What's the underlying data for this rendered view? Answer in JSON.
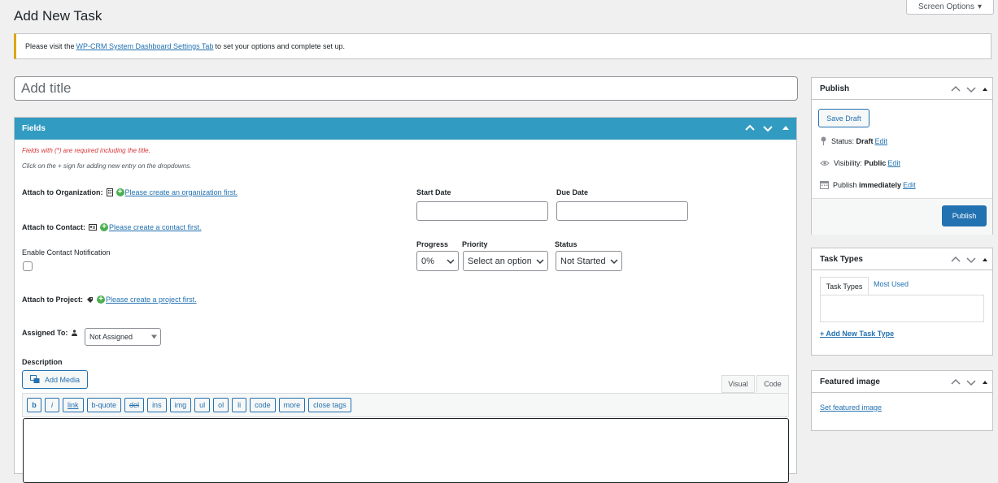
{
  "page": {
    "title": "Add New Task"
  },
  "screen_options": {
    "label": "Screen Options"
  },
  "notice": {
    "prefix": "Please visit the ",
    "link": "WP-CRM System Dashboard Settings Tab",
    "suffix": " to set your options and complete set up."
  },
  "title_field": {
    "placeholder": "Add title"
  },
  "fields": {
    "header": "Fields",
    "required_note": "Fields with (*) are required including the title.",
    "help_note": "Click on the + sign for adding new entry on the dropdowns.",
    "organization": {
      "label": "Attach to Organization:",
      "link": "Please create an organization first."
    },
    "contact": {
      "label": "Attach to Contact:",
      "link": "Please create a contact first."
    },
    "notification": {
      "label": "Enable Contact Notification"
    },
    "project": {
      "label": "Attach to Project:",
      "link": "Please create a project first."
    },
    "assigned": {
      "label": "Assigned To:",
      "value": "Not Assigned"
    },
    "start_date": {
      "label": "Start Date"
    },
    "due_date": {
      "label": "Due Date"
    },
    "progress": {
      "label": "Progress",
      "value": "0%"
    },
    "priority": {
      "label": "Priority",
      "value": "Select an option"
    },
    "status": {
      "label": "Status",
      "value": "Not Started"
    },
    "description": {
      "label": "Description",
      "add_media": "Add Media",
      "tab_visual": "Visual",
      "tab_code": "Code",
      "quicktags": [
        "b",
        "i",
        "link",
        "b-quote",
        "del",
        "ins",
        "img",
        "ul",
        "ol",
        "li",
        "code",
        "more",
        "close tags"
      ]
    }
  },
  "publish": {
    "header": "Publish",
    "save_draft": "Save Draft",
    "status_label": "Status: ",
    "status_value": "Draft",
    "visibility_label": "Visibility: ",
    "visibility_value": "Public",
    "publish_label": "Publish ",
    "publish_value": "immediately",
    "edit": "Edit",
    "publish_button": "Publish"
  },
  "task_types": {
    "header": "Task Types",
    "tab_all": "Task Types",
    "tab_most_used": "Most Used",
    "add_new": "+ Add New Task Type"
  },
  "featured_image": {
    "header": "Featured image",
    "link": "Set featured image"
  },
  "colors": {
    "accent": "#329bc1",
    "link": "#2271b1",
    "primary": "#2271b1",
    "notice": "#dba617",
    "required": "#d63638"
  }
}
